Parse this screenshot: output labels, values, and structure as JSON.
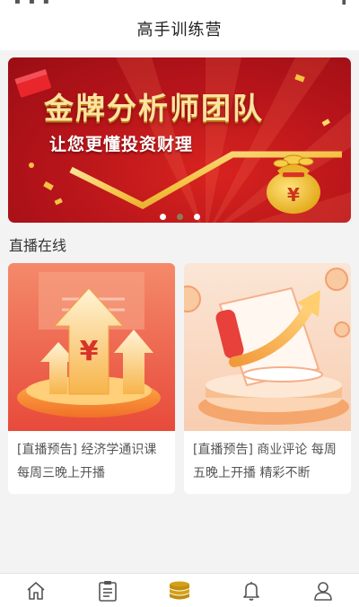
{
  "header": {
    "title": "高手训练营"
  },
  "banner": {
    "title": "金牌分析师团队",
    "subtitle": "让您更懂投资财理",
    "pages": 3,
    "active_page": 2
  },
  "live": {
    "section_title": "直播在线",
    "cards": [
      {
        "text": "[直播预告] 经济学通识课 每周三晚上开播"
      },
      {
        "text": "[直播预告] 商业评论 每周五晚上开播 精彩不断"
      }
    ]
  },
  "tabbar": {
    "items": [
      {
        "icon": "home-icon"
      },
      {
        "icon": "clipboard-icon"
      },
      {
        "icon": "coins-icon",
        "active": true
      },
      {
        "icon": "bell-icon"
      },
      {
        "icon": "user-icon"
      }
    ],
    "active_color": "#d4a017",
    "inactive_color": "#555555"
  },
  "colors": {
    "banner_red": "#c0171d",
    "gold": "#f5c242"
  }
}
